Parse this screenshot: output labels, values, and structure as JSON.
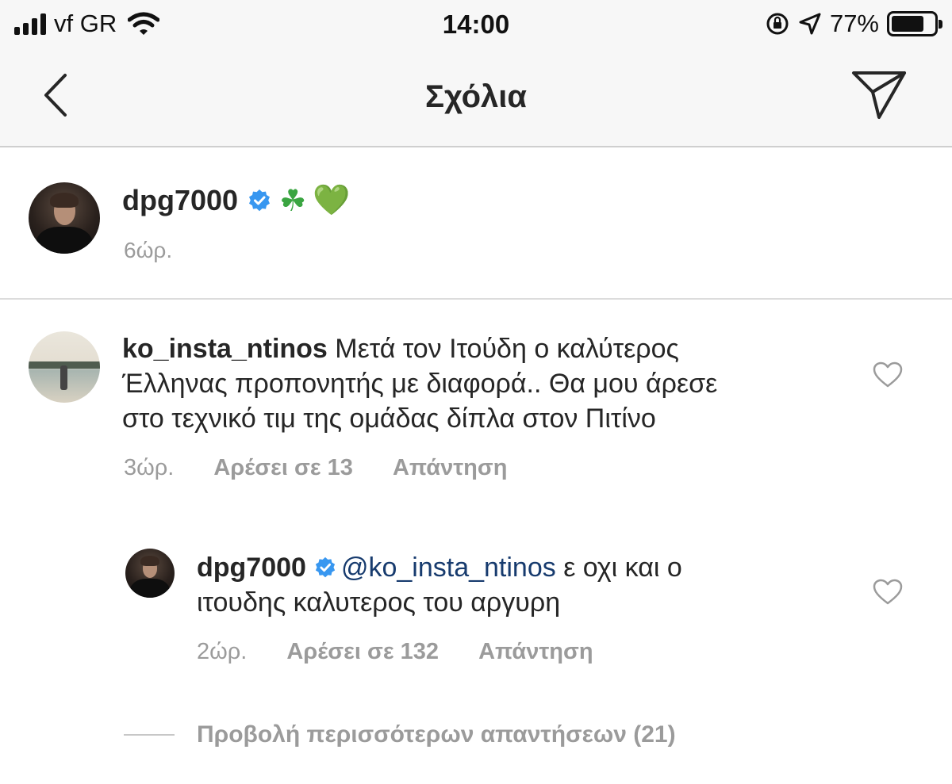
{
  "status_bar": {
    "carrier": "vf GR",
    "time": "14:00",
    "battery_percent": "77%",
    "battery_level": 0.77,
    "icons": [
      "signal-icon",
      "wifi-icon",
      "orientation-lock-icon",
      "location-icon",
      "battery-icon"
    ]
  },
  "nav": {
    "title": "Σχόλια",
    "back_icon": "chevron-left-icon",
    "send_icon": "paper-plane-icon"
  },
  "caption": {
    "username": "dpg7000",
    "verified": true,
    "emojis": "☘️ 💚",
    "emoji_clover": "☘",
    "emoji_heart": "💚",
    "time": "6ώρ."
  },
  "comments": [
    {
      "username": "ko_insta_ntinos",
      "text": "Μετά τον Ιτούδη ο καλύτερος Έλληνας προπονητής με διαφορά.. Θα μου άρεσε στο τεχνικό τιμ της ομάδας δίπλα στον Πιτίνο",
      "line1": "Μετά τον Ιτούδη ο καλύτερος",
      "line2": "Έλληνας προπονητής με διαφορά.. Θα μου άρεσε",
      "line3": "στο τεχνικό τιμ της ομάδας δίπλα στον Πιτίνο",
      "time": "3ώρ.",
      "likes": "Αρέσει σε 13",
      "reply_label": "Απάντηση"
    }
  ],
  "reply": {
    "username": "dpg7000",
    "verified": true,
    "mention": "@ko_insta_ntinos",
    "text": "@ko_insta_ntinos ε οχι και ο ιτουδης καλυτερος του αργυρη",
    "text_after_mention": " ε οχι και ο",
    "line2": "ιτουδης καλυτερος του αργυρη",
    "time": "2ώρ.",
    "likes": "Αρέσει σε 132",
    "reply_label": "Απάντηση"
  },
  "view_more_replies": "Προβολή περισσότερων απαντήσεων (21)",
  "colors": {
    "bar_background": "#f7f7f7",
    "text_primary": "#262626",
    "text_secondary": "#9b9b9b",
    "mention": "#173b6e",
    "verified_badge": "#3897f0"
  }
}
